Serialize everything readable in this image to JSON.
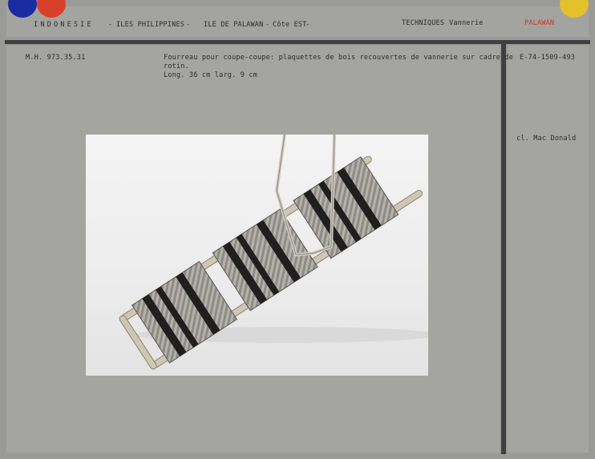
{
  "header": {
    "country": "INDONESIE",
    "sep1": "-",
    "region": "ILES PHILIPPINES",
    "sep2": "-",
    "island": "ILE DE PALAWAN",
    "sep3": "-",
    "coast": "Côte EST",
    "sep4": "-",
    "technique_label": "TECHNIQUES",
    "technique_value": "Vannerie",
    "stamp": "PALAWAN"
  },
  "record": {
    "inventory_number": "M.H. 973.35.31",
    "description_line1": "Fourreau pour coupe-coupe: plaquettes de bois recouvertes de vannerie sur cadre de",
    "description_line2": "rotin.",
    "dimensions": "Long. 36 cm  larg. 9 cm",
    "photo_number": "E-74-1509-493",
    "photographer": "cl. Mac Donald"
  },
  "colors": {
    "dot_blue": "#1a2aa0",
    "dot_red": "#d8402c",
    "dot_yellow": "#e4c12a",
    "stamp_red": "#c23a2a"
  },
  "photo": {
    "subject": "woven rattan sheath with rope",
    "icon": "photograph"
  }
}
